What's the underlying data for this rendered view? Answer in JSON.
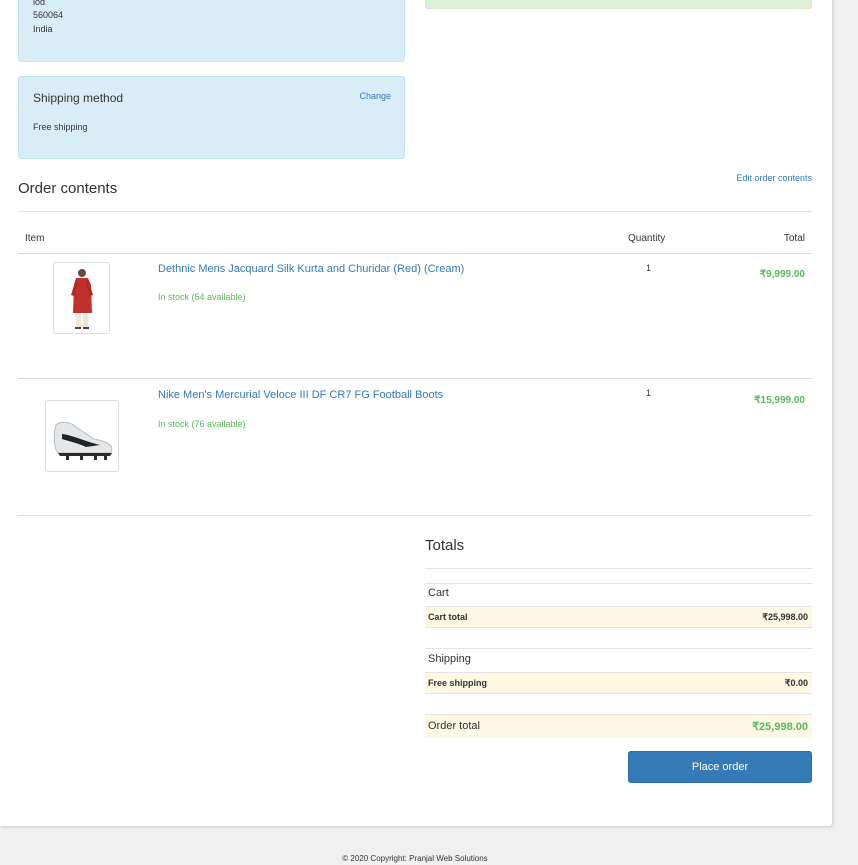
{
  "address": {
    "lines": [
      "lod",
      "560064",
      "India"
    ]
  },
  "shipping_method": {
    "title": "Shipping method",
    "change_label": "Change",
    "value": "Free shipping"
  },
  "order_contents": {
    "title": "Order contents",
    "edit_label": "Edit order contents",
    "headers": {
      "item": "Item",
      "quantity": "Quantity",
      "total": "Total"
    },
    "items": [
      {
        "name": "Dethnic Mens Jacquard Silk Kurta and Churidar (Red) (Cream)",
        "stock": "In stock (54 available)",
        "quantity": "1",
        "total": "₹9,999.00",
        "image_icon": "kurta-product-image"
      },
      {
        "name": "Nike Men's Mercurial Veloce III DF CR7 FG Football Boots",
        "stock": "In stock (76 available)",
        "quantity": "1",
        "total": "₹15,999.00",
        "image_icon": "football-boot-product-image"
      }
    ]
  },
  "totals": {
    "title": "Totals",
    "cart_label": "Cart",
    "cart_total_label": "Cart total",
    "cart_total_value": "₹25,998.00",
    "shipping_label": "Shipping",
    "free_shipping_label": "Free shipping",
    "free_shipping_value": "₹0.00",
    "order_total_label": "Order total",
    "order_total_value": "₹25,998.00"
  },
  "place_order_label": "Place order",
  "footer_text": "© 2020 Copyright: Pranjal Web Solutions",
  "colors": {
    "link": "#337ab7",
    "in_stock": "#5cb85c",
    "info_panel": "#d9edf7",
    "totals_row": "#fcf8e3",
    "primary_button": "#337ab7"
  }
}
